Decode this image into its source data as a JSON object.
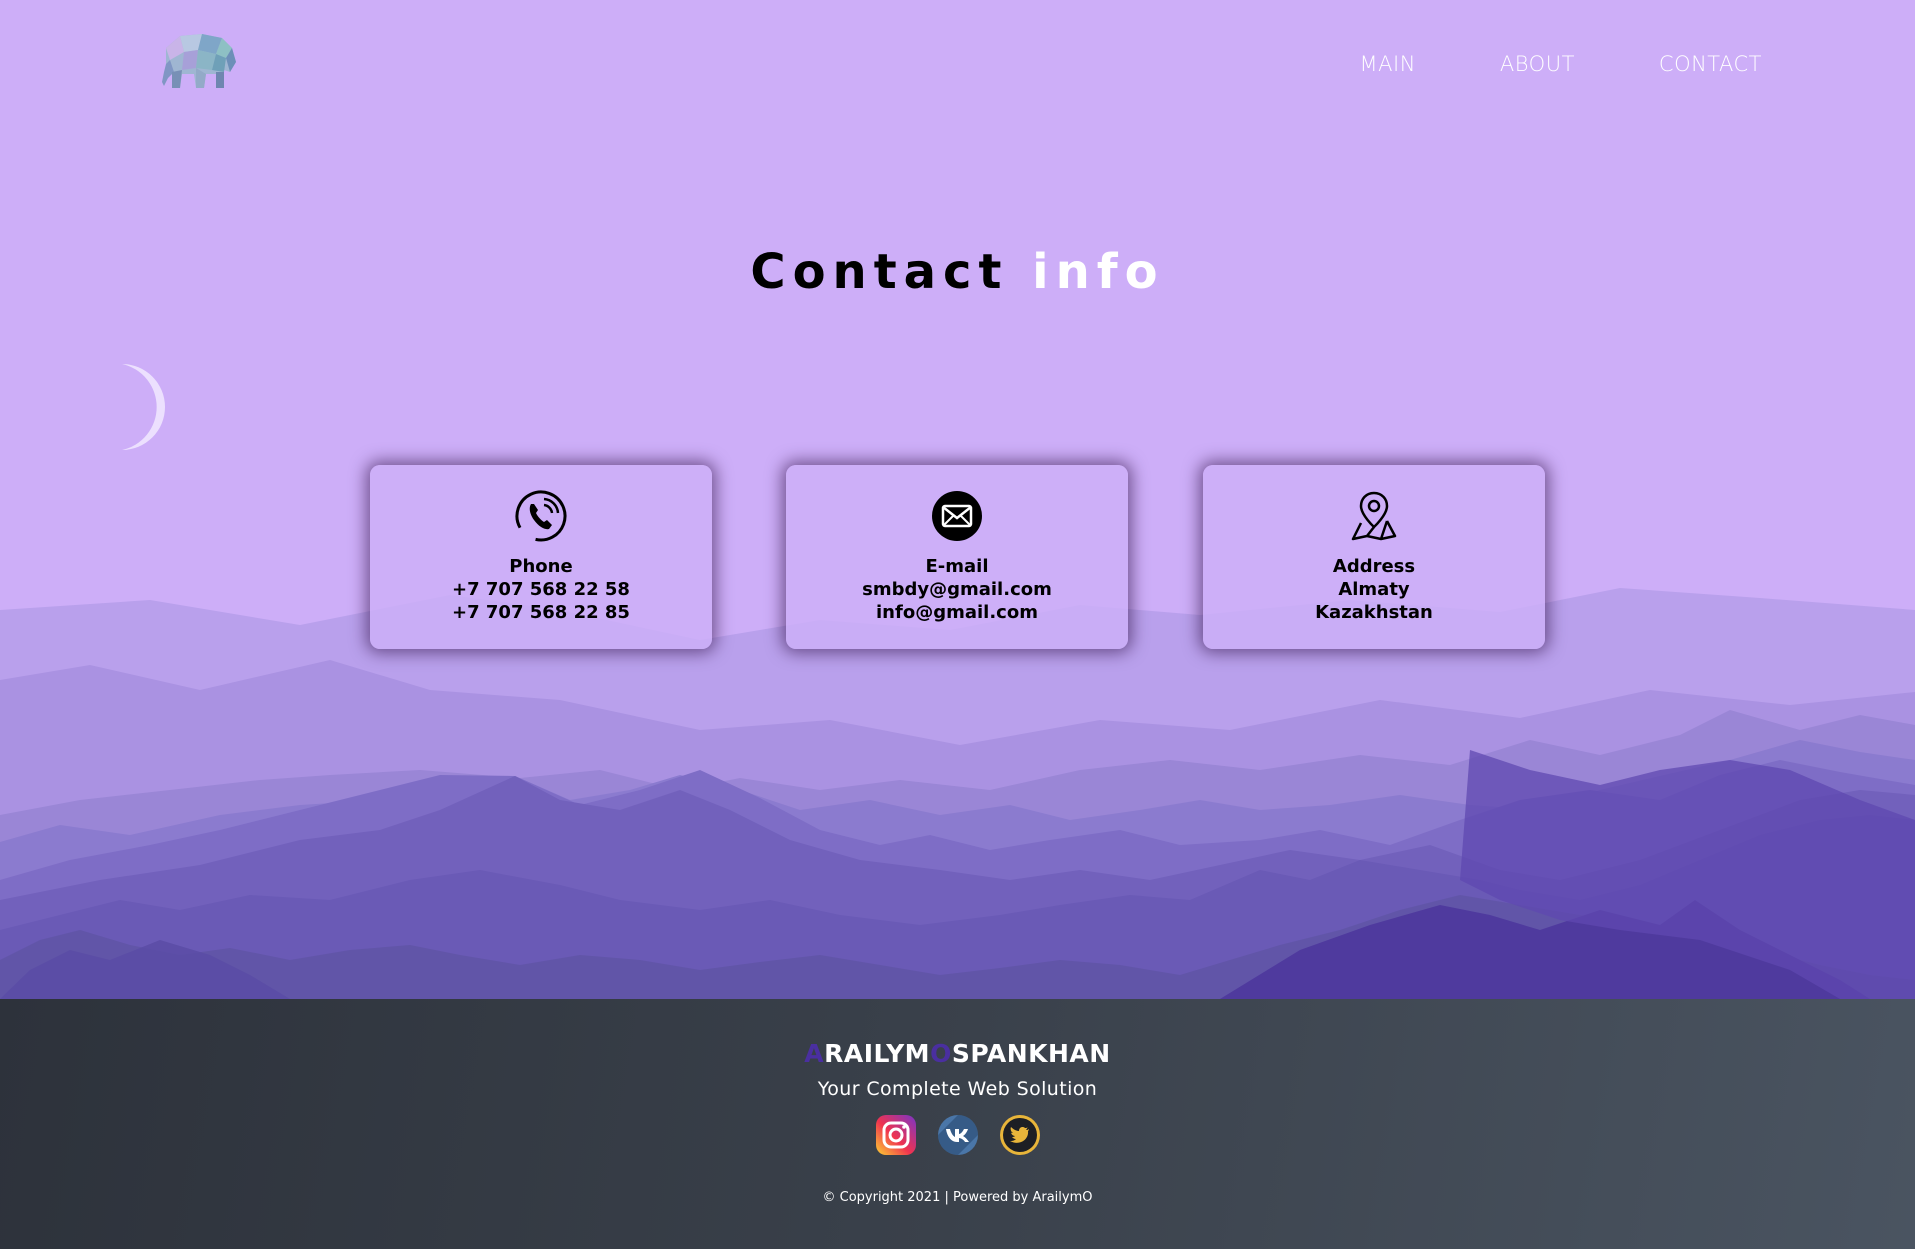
{
  "nav": {
    "items": [
      {
        "label": "MAIN"
      },
      {
        "label": "ABOUT"
      },
      {
        "label": "CONTACT"
      }
    ]
  },
  "hero": {
    "title_part1": "Contact",
    "title_part2": "info"
  },
  "cards": [
    {
      "icon": "phone-icon",
      "heading": "Phone",
      "lines": [
        "+7 707 568 22 58",
        "+7 707 568 22 85"
      ]
    },
    {
      "icon": "email-icon",
      "heading": "E-mail",
      "lines": [
        "smbdy@gmail.com",
        "info@gmail.com"
      ]
    },
    {
      "icon": "map-pin-icon",
      "heading": "Address",
      "lines": [
        "Almaty",
        "Kazakhstan"
      ]
    }
  ],
  "footer": {
    "brand_first_initial": "A",
    "brand_first_rest": "RAILYM",
    "brand_last_initial": "O",
    "brand_last_rest": "SPANKHAN",
    "tagline": "Your Complete Web Solution",
    "socials": [
      "instagram-icon",
      "vk-icon",
      "twitter-icon"
    ],
    "copyright": "© Copyright 2021 | Powered by ArailymO"
  },
  "colors": {
    "sky": "#cdaef8",
    "footer_bg": "#343a43",
    "brand_accent": "#4a2fa0"
  }
}
